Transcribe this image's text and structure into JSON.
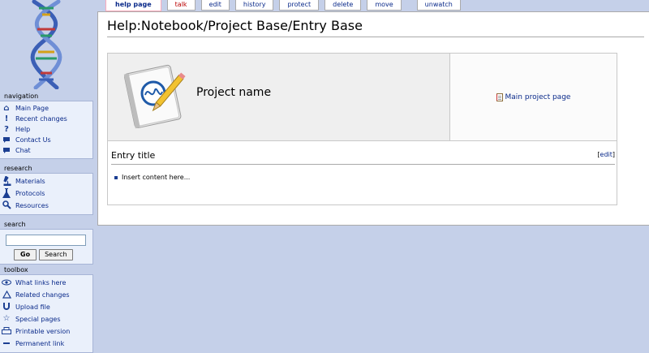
{
  "sidebar": {
    "navigation": {
      "title": "navigation",
      "items": [
        {
          "label": "Main Page",
          "icon": "home-icon"
        },
        {
          "label": "Recent changes",
          "icon": "exclamation-icon"
        },
        {
          "label": "Help",
          "icon": "question-icon"
        },
        {
          "label": "Contact Us",
          "icon": "speech-bubble-icon"
        },
        {
          "label": "Chat",
          "icon": "chat-icon"
        }
      ]
    },
    "research": {
      "title": "research",
      "items": [
        {
          "label": "Materials",
          "icon": "microscope-icon"
        },
        {
          "label": "Protocols",
          "icon": "flask-icon"
        },
        {
          "label": "Resources",
          "icon": "magnifier-icon"
        }
      ]
    },
    "search": {
      "title": "search",
      "input_value": "",
      "go_label": "Go",
      "search_label": "Search"
    },
    "toolbox": {
      "title": "toolbox",
      "items": [
        {
          "label": "What links here",
          "icon": "eye-icon"
        },
        {
          "label": "Related changes",
          "icon": "triangle-icon"
        },
        {
          "label": "Upload file",
          "icon": "upload-icon"
        },
        {
          "label": "Special pages",
          "icon": "star-icon"
        },
        {
          "label": "Printable version",
          "icon": "printer-icon"
        },
        {
          "label": "Permanent link",
          "icon": "link-icon"
        }
      ]
    }
  },
  "tabs": [
    {
      "label": "help page",
      "selected": true
    },
    {
      "label": "talk",
      "new": true
    },
    {
      "label": "edit"
    },
    {
      "label": "history"
    },
    {
      "label": "protect"
    },
    {
      "label": "delete"
    },
    {
      "label": "move"
    },
    {
      "label": "unwatch"
    }
  ],
  "page": {
    "title": "Help:Notebook/Project Base/Entry Base",
    "project_name": "Project name",
    "main_project_link": "Main project page",
    "entry_title": "Entry title",
    "edit_open": "[",
    "edit_label": "edit",
    "edit_close": "]",
    "entry_content": "Insert content here..."
  },
  "colors": {
    "background": "#c5d0e9",
    "link": "#0a2a8a",
    "new_link": "#ba0000"
  }
}
